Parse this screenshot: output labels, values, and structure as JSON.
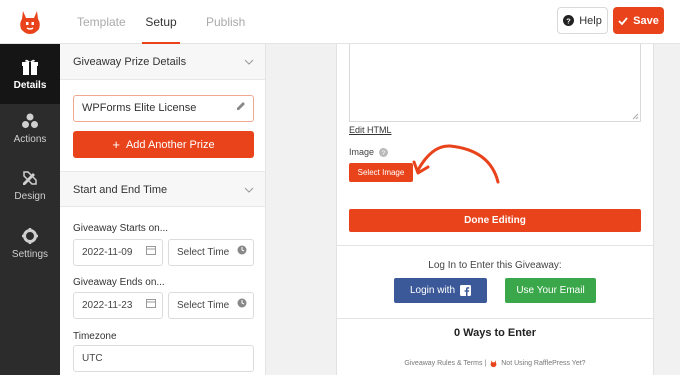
{
  "header": {
    "tabs": [
      {
        "label": "Template"
      },
      {
        "label": "Setup"
      },
      {
        "label": "Publish"
      }
    ],
    "help_label": "Help",
    "save_label": "Save",
    "brand_color": "#e8431b"
  },
  "sidebar": {
    "items": [
      {
        "label": "Details",
        "icon": "gift-icon"
      },
      {
        "label": "Actions",
        "icon": "shapes-icon"
      },
      {
        "label": "Design",
        "icon": "pencil-ruler-icon"
      },
      {
        "label": "Settings",
        "icon": "gear-icon"
      }
    ]
  },
  "panel": {
    "prize_section": "Giveaway Prize Details",
    "prize_value": "WPForms Elite License",
    "add_prize_label": "Add Another Prize",
    "time_section": "Start and End Time",
    "starts_label": "Giveaway Starts on...",
    "start_date": "2022-11-09",
    "start_time_placeholder": "Select Time",
    "ends_label": "Giveaway Ends on...",
    "end_date": "2022-11-23",
    "end_time_placeholder": "Select Time",
    "timezone_label": "Timezone",
    "timezone_value": "UTC"
  },
  "preview": {
    "edit_html": "Edit HTML",
    "image_label": "Image",
    "select_image_label": "Select Image",
    "done_label": "Done Editing",
    "login_heading": "Log In to Enter this Giveaway:",
    "facebook_label": "Login with",
    "email_label": "Use Your Email",
    "ways_heading": "0 Ways to Enter",
    "footer_rules": "Giveaway Rules & Terms |",
    "footer_promo": "Not Using RafflePress Yet?",
    "facebook_color": "#3b5998",
    "email_color": "#3aa74a"
  }
}
